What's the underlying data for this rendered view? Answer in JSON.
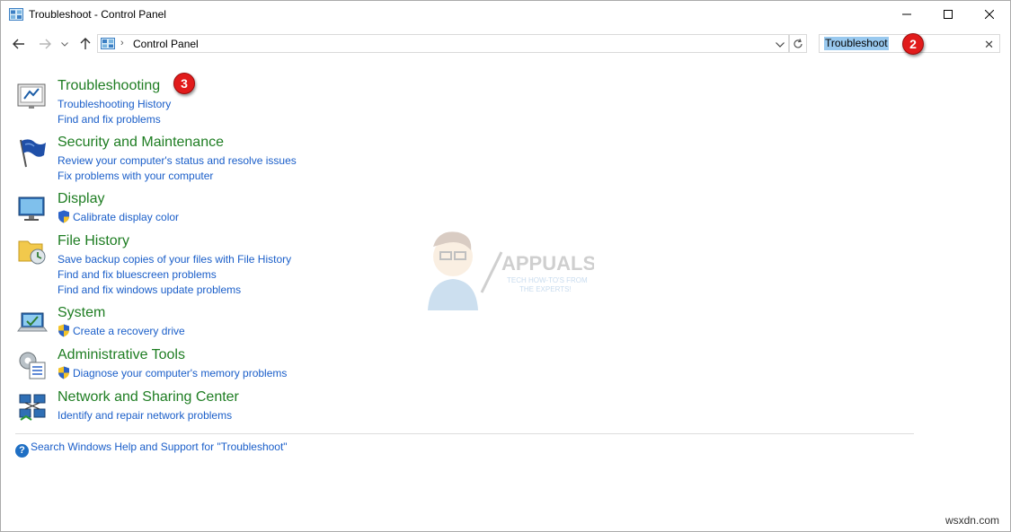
{
  "window": {
    "title": "Troubleshoot - Control Panel"
  },
  "address_bar": {
    "breadcrumb": "Control Panel"
  },
  "search": {
    "value": "Troubleshoot"
  },
  "markers": {
    "search_step": "2",
    "result_step": "3"
  },
  "results": [
    {
      "title": "Troubleshooting",
      "icon": "troubleshooting-icon",
      "links": [
        "Troubleshooting History",
        "Find and fix problems"
      ]
    },
    {
      "title": "Security and Maintenance",
      "icon": "flag-icon",
      "links": [
        "Review your computer's status and resolve issues",
        "Fix problems with your computer"
      ]
    },
    {
      "title": "Display",
      "icon": "monitor-icon",
      "links": [
        "Calibrate display color"
      ]
    },
    {
      "title": "File History",
      "icon": "file-history-icon",
      "links": [
        "Save backup copies of your files with File History",
        "Find and fix bluescreen problems",
        "Find and fix windows update problems"
      ]
    },
    {
      "title": "System",
      "icon": "laptop-icon",
      "links": [
        "Create a recovery drive"
      ]
    },
    {
      "title": "Administrative Tools",
      "icon": "admin-tools-icon",
      "links": [
        "Diagnose your computer's memory problems"
      ]
    },
    {
      "title": "Network and Sharing Center",
      "icon": "network-icon",
      "links": [
        "Identify and repair network problems"
      ]
    }
  ],
  "help_link": "Search Windows Help and Support for \"Troubleshoot\"",
  "watermark": {
    "brand": "APPUALS",
    "tagline_1": "TECH HOW-TO'S FROM",
    "tagline_2": "THE EXPERTS!"
  },
  "site_credit": "wsxdn.com",
  "colors": {
    "title_green": "#1e7d22",
    "link_blue": "#1a5ec9",
    "marker_red": "#e11b1b",
    "selection": "#99c9ef"
  }
}
